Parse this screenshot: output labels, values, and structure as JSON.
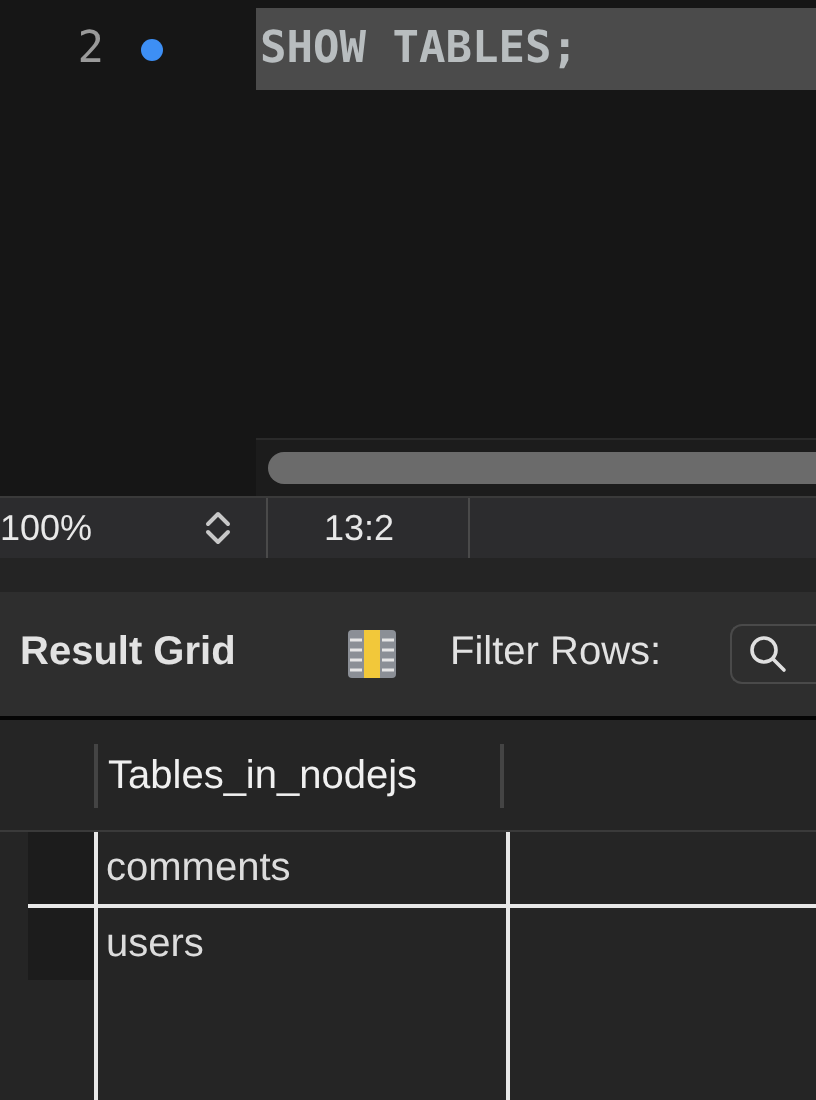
{
  "editor": {
    "lines": [
      {
        "number": "2",
        "marker": true,
        "selected": true,
        "code": "SHOW TABLES;"
      }
    ]
  },
  "status_bar": {
    "zoom": "100%",
    "cursor": "13:2"
  },
  "result_toolbar": {
    "title": "Result Grid",
    "filter_label": "Filter Rows:"
  },
  "table": {
    "columns": [
      "Tables_in_nodejs"
    ],
    "rows": [
      [
        "comments"
      ],
      [
        "users"
      ]
    ]
  }
}
